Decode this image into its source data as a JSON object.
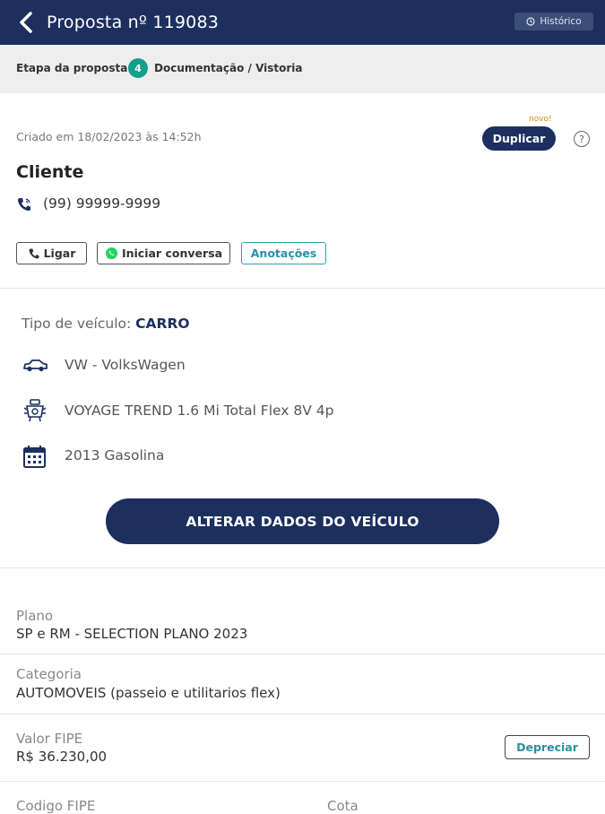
{
  "header": {
    "title": "Proposta nº 119083",
    "history_label": "Histórico"
  },
  "stage": {
    "label": "Etapa da proposta:",
    "number": "4",
    "name": "Documentação / Vistoria"
  },
  "client_card": {
    "created": "Criado em 18/02/2023 às 14:52h",
    "new_badge": "novo!",
    "duplicate_label": "Duplicar",
    "help_label": "?",
    "name": "Cliente",
    "phone": "(99) 99999-9999",
    "actions": {
      "call": "Ligar",
      "chat": "Iniciar conversa",
      "notes": "Anotações"
    }
  },
  "vehicle": {
    "type_label": "Tipo de veículo:",
    "type_value": "CARRO",
    "brand": "VW - VolksWagen",
    "model": "VOYAGE TREND 1.6 Mi Total Flex 8V 4p",
    "year": "2013 Gasolina",
    "change_button": "ALTERAR DADOS DO VEÍCULO"
  },
  "fields": {
    "plan_label": "Plano",
    "plan_value": "SP e RM - SELECTION PLANO 2023",
    "category_label": "Categoria",
    "category_value": "AUTOMOVEIS (passeio e utilitarios flex)",
    "fipe_value_label": "Valor FIPE",
    "fipe_value": "R$ 36.230,00",
    "depreciate_button": "Depreciar",
    "fipe_code_label": "Codigo FIPE",
    "quota_label": "Cota"
  },
  "colors": {
    "primary": "#1c2f5e",
    "accent_teal": "#13a08b",
    "link": "#2a8fa6",
    "new_orange": "#e0841a"
  }
}
